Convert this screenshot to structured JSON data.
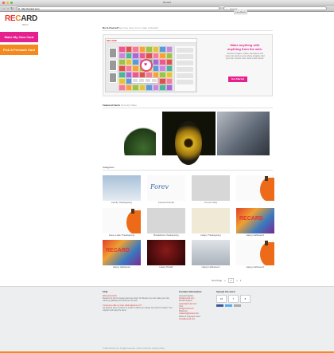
{
  "window": {
    "title": "Recard"
  },
  "browser": {
    "url": "http://recard.com",
    "search_placeholder": "Google"
  },
  "header": {
    "logo_re": "RE",
    "logo_c": "C",
    "logo_ard": "ARD",
    "tagline": "BETA",
    "feedback": "Feedback"
  },
  "sidebar": {
    "make_label": "Make My Own Card",
    "pick_label": "Pick A Premade Card"
  },
  "hero": {
    "section_bold": "Do-It-Yourself",
    "section_rest": "See how easy it is to make a Recard!",
    "app_logo": "RECARD",
    "heading": "Make anything with anything from the web.",
    "text": "Combine images, videos, animations and more into cards you can share instantly. Add your own content, then share it with friends.",
    "cta": "Get Started"
  },
  "featured": {
    "label_bold": "Featured Cards",
    "label_rest": "Recently Made"
  },
  "categories": {
    "label": "Categories",
    "items": [
      {
        "caption": "Family Thanksgiving",
        "style": "t-blue"
      },
      {
        "caption": "Forever Friends",
        "style": "t-white",
        "art": "Forev"
      },
      {
        "caption": "You so Crazy",
        "style": "t-grey"
      },
      {
        "caption": "",
        "style": "t-white",
        "pumpkin": true
      },
      {
        "caption": "Have a safe Thanksgiving",
        "style": "t-white",
        "pumpkin": true
      },
      {
        "caption": "Breakdance thanksgiving",
        "style": "t-grey"
      },
      {
        "caption": "Happy Thanksgiving",
        "style": "t-beige"
      },
      {
        "caption": "Happy Halloween!",
        "style": "t-colors",
        "art": "RECARD"
      },
      {
        "caption": "Happy Halloween",
        "style": "t-colors",
        "art": "RECARD"
      },
      {
        "caption": "Happy Diwali!",
        "style": "t-red"
      },
      {
        "caption": "Happy Halloween!",
        "style": "t-soft"
      },
      {
        "caption": "Happy Halloween!",
        "style": "t-white",
        "pumpkin": true
      }
    ]
  },
  "pager": {
    "label": "Next Page",
    "prev": "«",
    "current": "1",
    "next": "»",
    "last": "2"
  },
  "footer": {
    "faq": {
      "title": "FAQ",
      "q1": "What is Recard?",
      "a1": "Recard is a tool for people who love cards. On Recard, you can make your own cards by grabbing cool stuff from the web.",
      "q2": "If someone edits my card, what happens to it?",
      "a2": "On Recard, when a card is re-made or edited, an entirely new card is created. Your original card stays the same."
    },
    "contact": {
      "title": "Contact Information",
      "general": "General Inquiries",
      "general_mail": "hello@recard.com",
      "support": "Recard Support",
      "support_mail": "support@recard.com",
      "jobs": "Jobs",
      "jobs_mail": "jobs@recard.com",
      "marketing": "Marketing",
      "marketing_mail": "marketing@recard.com",
      "dmca": "DMCA & Copyright notice",
      "dmca_mail": "dmca@recard.com"
    },
    "share": {
      "title": "Spread the word",
      "counts": [
        "15",
        "7",
        "8"
      ]
    },
    "copyright": "© 2011 Recard, Inc. All rights reserved. | Terms of Service | Privacy Policy"
  },
  "colors": {
    "accent_pink": "#e6218e",
    "accent_orange": "#f48a1e",
    "brand_red": "#e6322e"
  }
}
